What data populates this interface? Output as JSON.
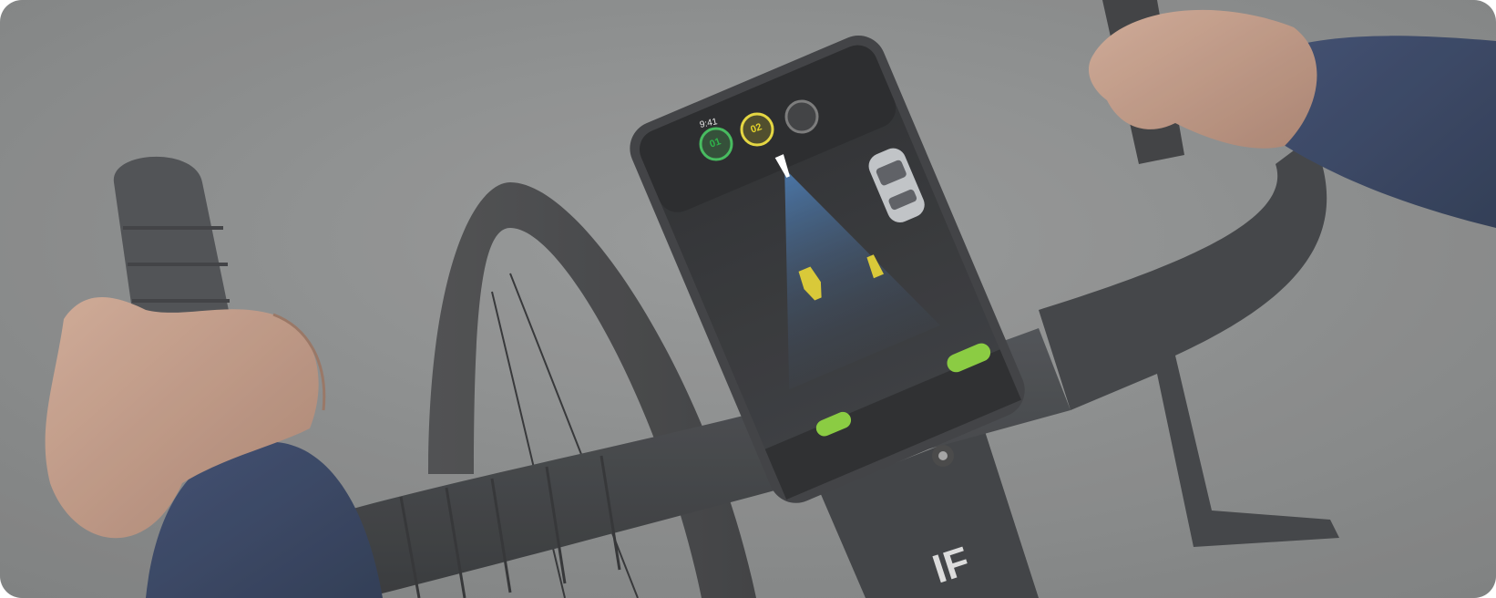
{
  "scene": {
    "description_kind": "photo",
    "subject_elements": [
      "road-surface",
      "bicycle-handlebar",
      "left-hand",
      "right-hand",
      "front-tire",
      "phone-mount",
      "smartphone"
    ]
  },
  "phone_app": {
    "status_time": "9:41",
    "indicators": [
      {
        "label": "01",
        "color": "#2fb34a"
      },
      {
        "label": "02",
        "color": "#e2d22a"
      },
      {
        "label": "",
        "color": "#6b6b6b"
      }
    ],
    "tabbar": [
      "",
      "",
      ""
    ]
  },
  "colors": {
    "road": "#7d7f7f",
    "screen_bg": "#1b1c1f",
    "radar_beam": "#3a7fd0",
    "accent_green": "#7cc52a",
    "accent_yellow": "#d8c21e",
    "sleeve": "#1f2c4a",
    "skin": "#b98c72",
    "bar_tape": "#2c2e31"
  }
}
